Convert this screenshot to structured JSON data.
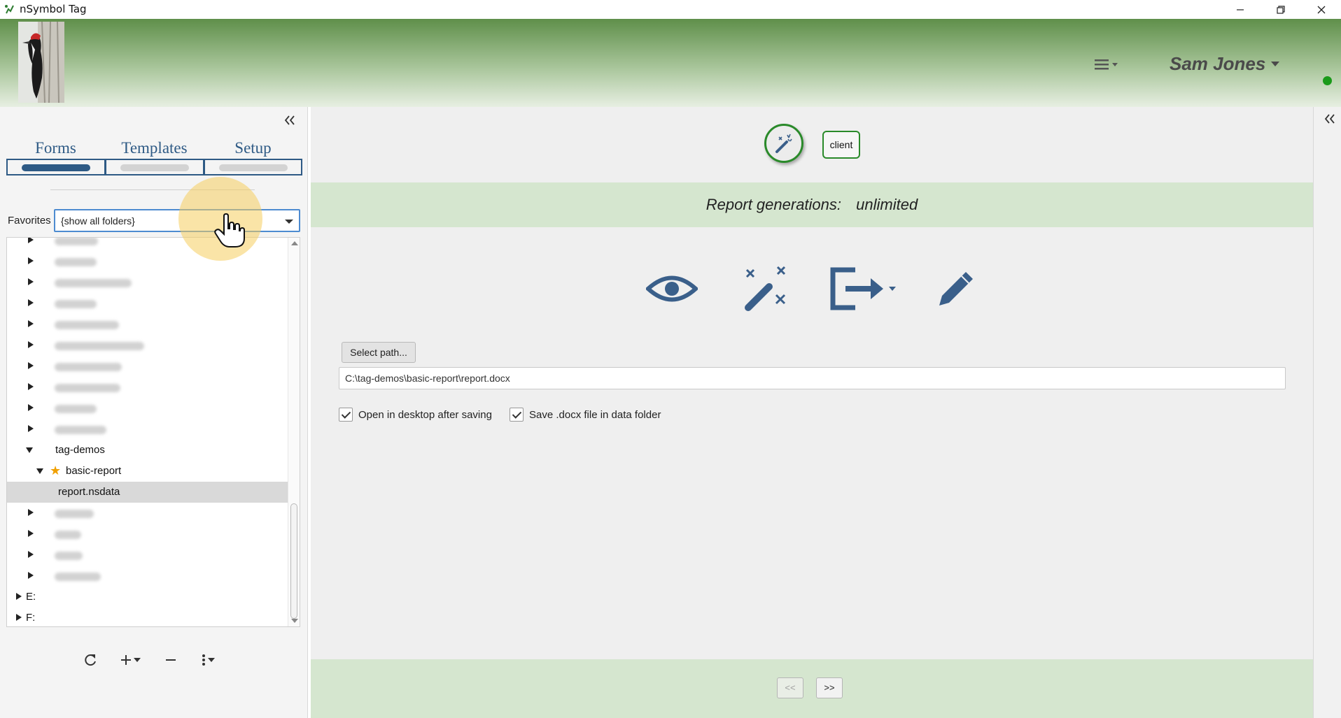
{
  "window": {
    "title": "nSymbol Tag"
  },
  "header": {
    "user_name": "Sam Jones",
    "status_color": "#1a9a1a",
    "accent_color": "#2e5a85"
  },
  "sidebar": {
    "tabs": [
      {
        "label": "Forms",
        "active": true
      },
      {
        "label": "Templates",
        "active": false
      },
      {
        "label": "Setup",
        "active": false
      }
    ],
    "favorites_label": "Favorites",
    "favorites_value": "{show all folders}",
    "tree": {
      "expanded_folder": "tag-demos",
      "expanded_subfolder": "basic-report",
      "selected_file": "report.nsdata",
      "drives": [
        "E:",
        "F:"
      ]
    }
  },
  "main": {
    "client_label": "client",
    "report_generations_label": "Report generations:",
    "report_generations_value": "unlimited",
    "select_path_label": "Select path...",
    "output_path": "C:\\tag-demos\\basic-report\\report.docx",
    "checkboxes": [
      {
        "label": "Open in desktop after saving",
        "checked": true
      },
      {
        "label": "Save .docx file in data folder",
        "checked": true
      }
    ],
    "nav_prev_label": "<<",
    "nav_next_label": ">>"
  }
}
